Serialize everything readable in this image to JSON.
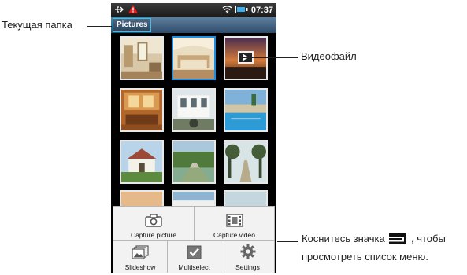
{
  "status_bar": {
    "time": "07:37",
    "icons": [
      "usb-icon",
      "warning-icon",
      "wifi-icon",
      "battery-icon"
    ]
  },
  "folder": {
    "label": "Pictures"
  },
  "thumbnails": [
    {
      "subject": "interior-room",
      "selected": false,
      "video": false
    },
    {
      "subject": "bedroom-interior",
      "selected": true,
      "video": false
    },
    {
      "subject": "sunset-video",
      "selected": false,
      "video": true
    },
    {
      "subject": "living-room",
      "selected": false,
      "video": false
    },
    {
      "subject": "white-house",
      "selected": false,
      "video": false
    },
    {
      "subject": "pool",
      "selected": false,
      "video": false
    },
    {
      "subject": "villa",
      "selected": false,
      "video": false
    },
    {
      "subject": "garden-path",
      "selected": false,
      "video": false
    },
    {
      "subject": "trees-path",
      "selected": false,
      "video": false
    },
    {
      "subject": "partial-1",
      "selected": false,
      "video": false
    },
    {
      "subject": "partial-2",
      "selected": false,
      "video": false
    },
    {
      "subject": "partial-3",
      "selected": false,
      "video": false
    }
  ],
  "menu": {
    "capture_picture": "Capture picture",
    "capture_video": "Capture video",
    "slideshow": "Slideshow",
    "multiselect": "Multiselect",
    "settings": "Settings"
  },
  "callouts": {
    "current_folder": "Текущая папка",
    "video_file": "Видеофайл",
    "menu_hint_before": "Коснитесь значка",
    "menu_hint_after": ", чтобы",
    "menu_hint_line2": "просмотреть список меню."
  },
  "colors": {
    "accent_blue": "#1e8fe0",
    "folder_bar": "#3b5a7a",
    "menu_bg": "#f2f2f2"
  }
}
